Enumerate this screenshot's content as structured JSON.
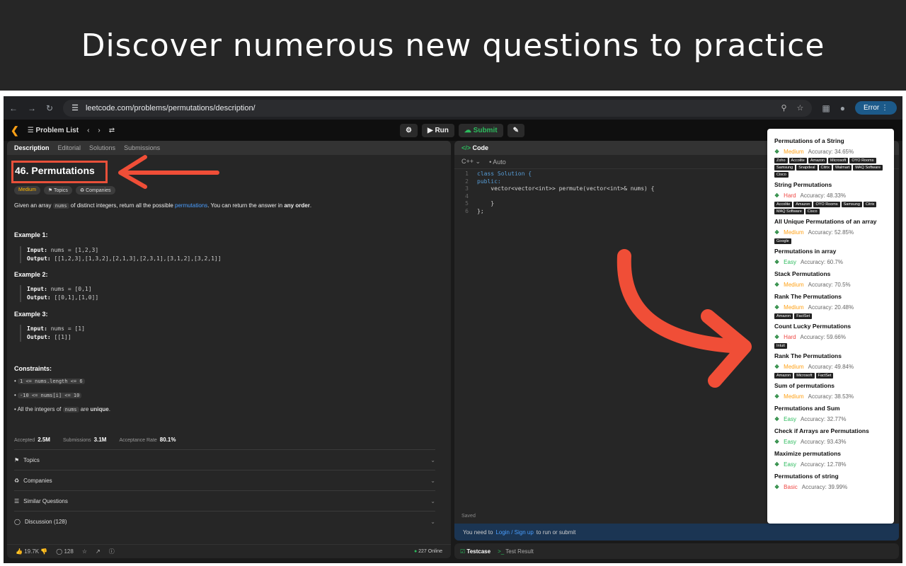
{
  "banner": {
    "title": "Discover numerous new questions to practice"
  },
  "browser": {
    "url": "leetcode.com/problems/permutations/description/",
    "error_label": "Error"
  },
  "lc_nav": {
    "problem_list": "Problem List",
    "run": "Run",
    "submit": "Submit"
  },
  "left_tabs": [
    "Description",
    "Editorial",
    "Solutions",
    "Submissions"
  ],
  "problem": {
    "title": "46. Permutations",
    "difficulty": "Medium",
    "topics_chip": "Topics",
    "companies_chip": "Companies",
    "desc_1": "Given an array",
    "desc_code": "nums",
    "desc_2": "of distinct integers, return all the possible",
    "desc_link": "permutations",
    "desc_3": ". You can return the answer in",
    "desc_bold": "any order",
    "desc_4": "."
  },
  "examples": [
    {
      "label": "Example 1:",
      "input": "nums = [1,2,3]",
      "output": "[[1,2,3],[1,3,2],[2,1,3],[2,3,1],[3,1,2],[3,2,1]]"
    },
    {
      "label": "Example 2:",
      "input": "nums = [0,1]",
      "output": "[[0,1],[1,0]]"
    },
    {
      "label": "Example 3:",
      "input": "nums = [1]",
      "output": "[[1]]"
    }
  ],
  "labels": {
    "input": "Input:",
    "output": "Output:",
    "constraints": "Constraints:"
  },
  "constraints": {
    "c1": "1 <= nums.length <= 6",
    "c2": "-10 <= nums[i] <= 10",
    "c3_pre": "All the integers of",
    "c3_code": "nums",
    "c3_mid": "are",
    "c3_bold": "unique",
    "c3_end": "."
  },
  "stats": {
    "accepted_label": "Accepted",
    "accepted": "2.5M",
    "submissions_label": "Submissions",
    "submissions": "3.1M",
    "rate_label": "Acceptance Rate",
    "rate": "80.1%"
  },
  "sections": [
    "Topics",
    "Companies",
    "Similar Questions",
    "Discussion (128)"
  ],
  "footer": {
    "likes": "19.7K",
    "comments": "128",
    "online": "227 Online"
  },
  "editor": {
    "tab": "Code",
    "lang": "C++",
    "auto": "Auto",
    "lines": [
      [
        "1",
        "class Solution {"
      ],
      [
        "2",
        "public:"
      ],
      [
        "3",
        "    vector<vector<int>> permute(vector<int>& nums) {"
      ],
      [
        "4",
        ""
      ],
      [
        "5",
        "    }"
      ],
      [
        "6",
        "};"
      ]
    ],
    "saved": "Saved",
    "login_pre": "You need to",
    "login_link": "Login / Sign up",
    "login_post": "to run or submit",
    "testcase": "Testcase",
    "test_result": "Test Result"
  },
  "colors": {
    "medium": "#ffa116",
    "hard": "#ef4743",
    "easy": "#2cbb5d",
    "basic": "#ef4743",
    "arrow": "#f04e37"
  },
  "suggestions": [
    {
      "title": "Permutations of a String",
      "level": "Medium",
      "accuracy": "Accuracy: 34.65%",
      "tags": [
        "Zoho",
        "Accolite",
        "Amazon",
        "Microsoft",
        "OYO Rooms",
        "Samsung",
        "Snapdeal",
        "Citrix",
        "Walmart",
        "MAQ Software",
        "Cisco"
      ]
    },
    {
      "title": "String Permutations",
      "level": "Hard",
      "accuracy": "Accuracy: 48.33%",
      "tags": [
        "Accolite",
        "Amazon",
        "OYO Rooms",
        "Samsung",
        "Citrix",
        "MAQ Software",
        "Cisco"
      ]
    },
    {
      "title": "All Unique Permutations of an array",
      "level": "Medium",
      "accuracy": "Accuracy: 52.85%",
      "tags": [
        "Google"
      ]
    },
    {
      "title": "Permutations in array",
      "level": "Easy",
      "accuracy": "Accuracy: 60.7%",
      "tags": []
    },
    {
      "title": "Stack Permutations",
      "level": "Medium",
      "accuracy": "Accuracy: 70.5%",
      "tags": []
    },
    {
      "title": "Rank The Permutations",
      "level": "Medium",
      "accuracy": "Accuracy: 20.48%",
      "tags": [
        "Amazon",
        "FactSet"
      ]
    },
    {
      "title": "Count Lucky Permutations",
      "level": "Hard",
      "accuracy": "Accuracy: 59.66%",
      "tags": [
        "Intuit"
      ]
    },
    {
      "title": "Rank The Permutations",
      "level": "Medium",
      "accuracy": "Accuracy: 49.84%",
      "tags": [
        "Amazon",
        "Microsoft",
        "FactSet"
      ]
    },
    {
      "title": "Sum of permutations",
      "level": "Medium",
      "accuracy": "Accuracy: 38.53%",
      "tags": []
    },
    {
      "title": "Permutations and Sum",
      "level": "Easy",
      "accuracy": "Accuracy: 32.77%",
      "tags": []
    },
    {
      "title": "Check if Arrays are Permutations",
      "level": "Easy",
      "accuracy": "Accuracy: 93.43%",
      "tags": []
    },
    {
      "title": "Maximize permutations",
      "level": "Easy",
      "accuracy": "Accuracy: 12.78%",
      "tags": []
    },
    {
      "title": "Permutations of string",
      "level": "Basic",
      "accuracy": "Accuracy: 39.99%",
      "tags": []
    }
  ]
}
